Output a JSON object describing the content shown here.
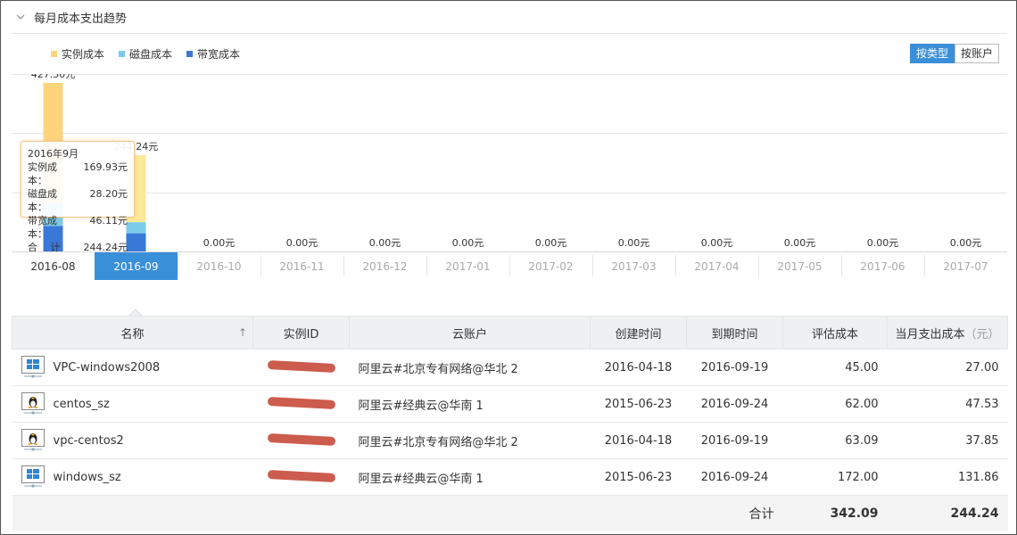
{
  "panel": {
    "title": "每月成本支出趋势"
  },
  "legend": [
    {
      "label": "实例成本",
      "color": "#fdd47c"
    },
    {
      "label": "磁盘成本",
      "color": "#7ccbea"
    },
    {
      "label": "带宽成本",
      "color": "#3a78d8"
    }
  ],
  "toggle": {
    "by_type": "按类型",
    "by_account": "按账户",
    "active": "by_type"
  },
  "chart_data": {
    "type": "bar",
    "stacked": true,
    "categories": [
      "2016-08",
      "2016-09",
      "2016-10",
      "2016-11",
      "2016-12",
      "2017-01",
      "2017-02",
      "2017-03",
      "2017-04",
      "2017-05",
      "2017-06",
      "2017-07"
    ],
    "selected_category": "2016-09",
    "series": [
      {
        "name": "实例成本",
        "color": "#fdd47c",
        "values": [
          305.0,
          169.93,
          0,
          0,
          0,
          0,
          0,
          0,
          0,
          0,
          0,
          0
        ]
      },
      {
        "name": "磁盘成本",
        "color": "#7ccbea",
        "values": [
          58.0,
          28.2,
          0,
          0,
          0,
          0,
          0,
          0,
          0,
          0,
          0,
          0
        ]
      },
      {
        "name": "带宽成本",
        "color": "#3a78d8",
        "values": [
          64.5,
          46.11,
          0,
          0,
          0,
          0,
          0,
          0,
          0,
          0,
          0,
          0
        ]
      }
    ],
    "totals_labels": [
      "427.50元",
      "244.24元",
      "0.00元",
      "0.00元",
      "0.00元",
      "0.00元",
      "0.00元",
      "0.00元",
      "0.00元",
      "0.00元",
      "0.00元",
      "0.00元"
    ],
    "totals": [
      427.5,
      244.24,
      0,
      0,
      0,
      0,
      0,
      0,
      0,
      0,
      0,
      0
    ],
    "ylim": [
      0,
      450
    ],
    "grid": true
  },
  "tooltip": {
    "title": "2016年9月",
    "rows": [
      {
        "k": "实例成本：",
        "v": "169.93元"
      },
      {
        "k": "磁盘成本：",
        "v": "28.20元"
      },
      {
        "k": "带宽成本：",
        "v": "46.11元"
      },
      {
        "k": "合　 计",
        "v": "244.24元"
      }
    ]
  },
  "table": {
    "headers": {
      "name": "名称",
      "sort": "↑",
      "instance_id": "实例ID",
      "account": "云账户",
      "created": "创建时间",
      "expires": "到期时间",
      "est_cost": "评估成本",
      "month_cost": "当月支出成本",
      "unit": "（元）"
    },
    "rows": [
      {
        "os": "windows-icon",
        "name": "VPC-windows2008",
        "account": "阿里云#北京专有网络@华北 2",
        "created": "2016-04-18",
        "expires": "2016-09-19",
        "est_cost": "45.00",
        "month_cost": "27.00"
      },
      {
        "os": "linux-icon",
        "name": "centos_sz",
        "account": "阿里云#经典云@华南 1",
        "created": "2015-06-23",
        "expires": "2016-09-24",
        "est_cost": "62.00",
        "month_cost": "47.53"
      },
      {
        "os": "linux-icon",
        "name": "vpc-centos2",
        "account": "阿里云#北京专有网络@华北 2",
        "created": "2016-04-18",
        "expires": "2016-09-19",
        "est_cost": "63.09",
        "month_cost": "37.85"
      },
      {
        "os": "windows-icon",
        "name": "windows_sz",
        "account": "阿里云#经典云@华南 1",
        "created": "2015-06-23",
        "expires": "2016-09-24",
        "est_cost": "172.00",
        "month_cost": "131.86"
      }
    ],
    "total": {
      "label": "合计",
      "est_cost": "342.09",
      "month_cost": "244.24"
    }
  }
}
